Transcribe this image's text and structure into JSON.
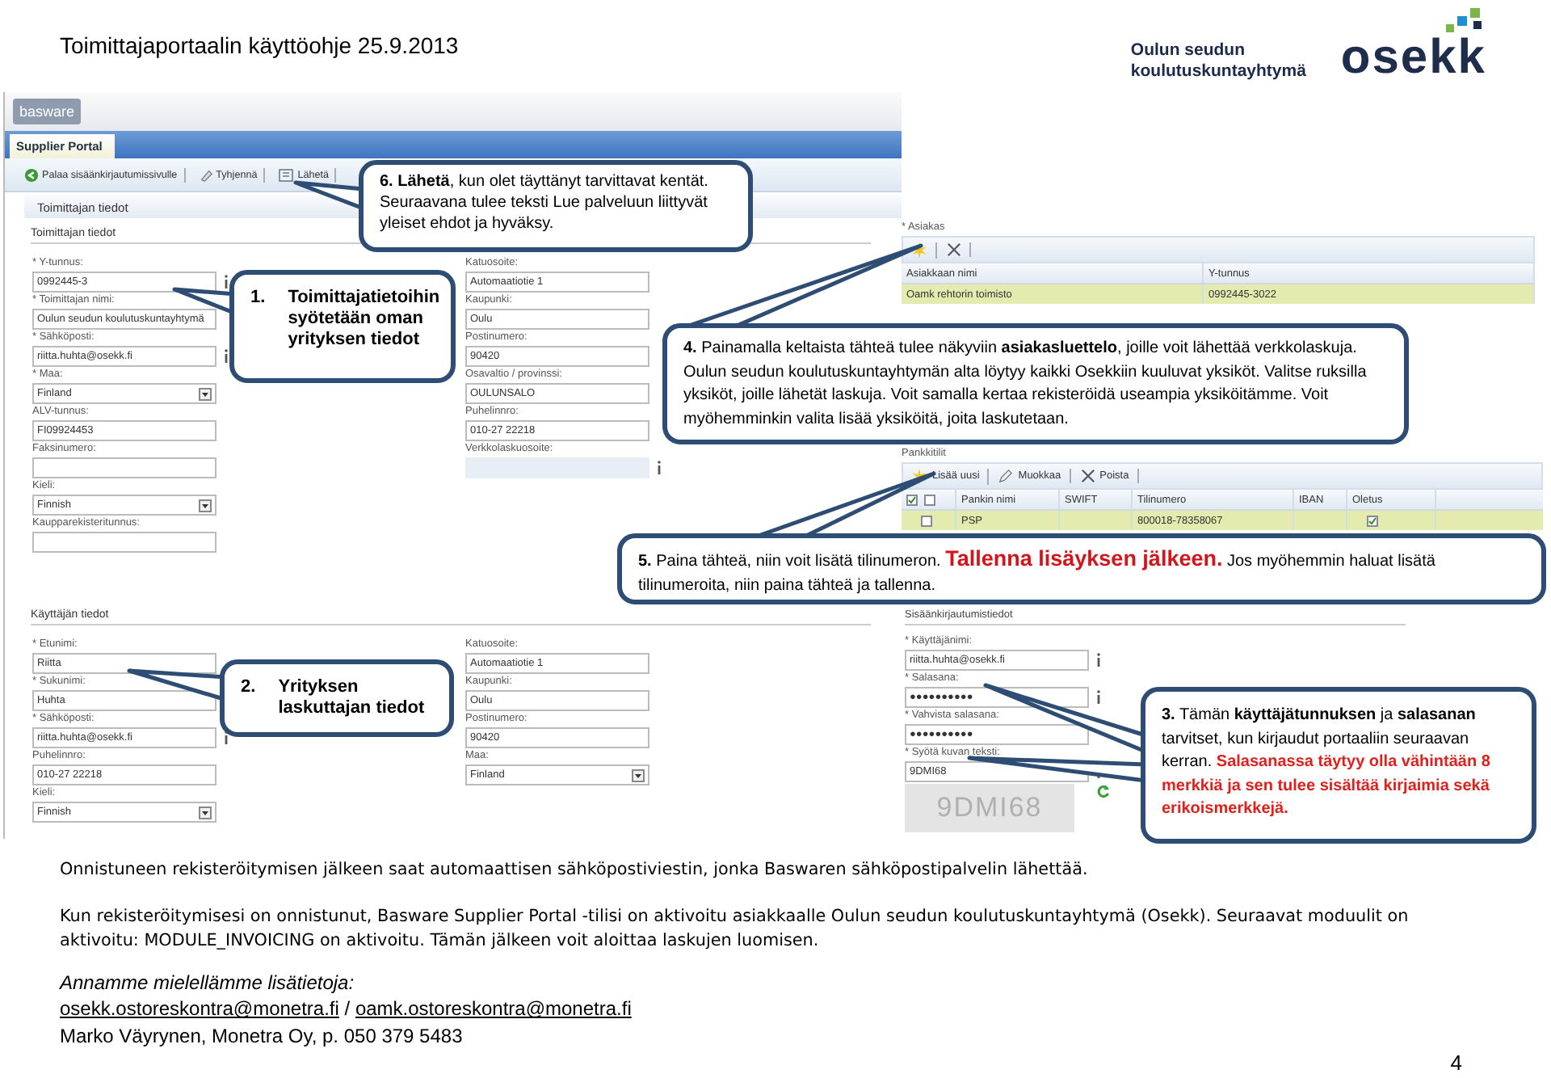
{
  "header": {
    "title": "Toimittajaportaalin käyttöohje 25.9.2013",
    "org_name": "Oulun seudun koulutuskuntayhtymä",
    "logo_text": "osekk"
  },
  "portal": {
    "logo_text": "basware",
    "tab": "Supplier Portal",
    "toolbar": [
      {
        "label": "Palaa sisäänkirjautumissivulle",
        "kind": "back"
      },
      {
        "label": "Tyhjennä",
        "kind": "eraser"
      },
      {
        "label": "Lähetä",
        "kind": "send"
      }
    ],
    "section_title": "Toimittajan tiedot",
    "supplier": {
      "heading": "Toimittajan tiedot",
      "left": [
        {
          "label": "* Y-tunnus:",
          "value": "0992445-3",
          "kind": "text",
          "info": true
        },
        {
          "label": "* Toimittajan nimi:",
          "value": "Oulun seudun koulutuskuntayhtymä",
          "kind": "text",
          "info": false
        },
        {
          "label": "* Sähköposti:",
          "value": "riitta.huhta@osekk.fi",
          "kind": "text",
          "info": true
        },
        {
          "label": "* Maa:",
          "value": "Finland",
          "kind": "select",
          "info": false
        },
        {
          "label": "ALV-tunnus:",
          "value": "FI09924453",
          "kind": "text",
          "info": false
        },
        {
          "label": "Faksinumero:",
          "kind": "text",
          "info": false
        },
        {
          "label": "Kieli:",
          "value": "Finnish",
          "kind": "select",
          "info": false
        },
        {
          "label": "Kaupparekisteritunnus:",
          "kind": "text",
          "info": false
        }
      ],
      "middle": [
        {
          "label": "Katuosoite:",
          "value": "Automaatiotie 1",
          "kind": "text",
          "info": false
        },
        {
          "label": "Kaupunki:",
          "value": "Oulu",
          "kind": "text",
          "info": false
        },
        {
          "label": "Postinumero:",
          "value": "90420",
          "kind": "text",
          "info": false
        },
        {
          "label": "Osavaltio / provinssi:",
          "value": "OULUNSALO",
          "kind": "text",
          "info": false
        },
        {
          "label": "Puhelinnro:",
          "value": "010-27 22218",
          "kind": "text",
          "info": false
        },
        {
          "label": "Verkkolaskuosoite:",
          "kind": "readonly",
          "info": true
        }
      ]
    },
    "user": {
      "heading": "Käyttäjän tiedot",
      "left": [
        {
          "label": "* Etunimi:",
          "value": "Riitta",
          "kind": "text",
          "info": false
        },
        {
          "label": "* Sukunimi:",
          "value": "Huhta",
          "kind": "text",
          "info": false
        },
        {
          "label": "* Sähköposti:",
          "value": "riitta.huhta@osekk.fi",
          "kind": "text",
          "info": true
        },
        {
          "label": "Puhelinnro:",
          "value": "010-27 22218",
          "kind": "text",
          "info": false
        },
        {
          "label": "Kieli:",
          "value": "Finnish",
          "kind": "select",
          "info": false
        }
      ],
      "middle": [
        {
          "label": "Katuosoite:",
          "value": "Automaatiotie 1",
          "kind": "text",
          "info": false
        },
        {
          "label": "Kaupunki:",
          "value": "Oulu",
          "kind": "text",
          "info": false
        },
        {
          "label": "Postinumero:",
          "value": "90420",
          "kind": "text",
          "info": false
        },
        {
          "label": "Maa:",
          "value": "Finland",
          "kind": "select",
          "info": false
        }
      ]
    }
  },
  "customers": {
    "label": "* Asiakas",
    "toolbar": [
      {
        "kind": "star"
      },
      {
        "kind": "x"
      }
    ],
    "columns": [
      "Asiakkaan nimi",
      "Y-tunnus"
    ],
    "rows": [
      {
        "name": "Oamk rehtorin toimisto",
        "business_id": "0992445-3022",
        "selected": true
      }
    ]
  },
  "bank_accounts": {
    "label": "Pankkitilit",
    "toolbar": [
      {
        "label": "Lisää uusi",
        "kind": "star"
      },
      {
        "label": "Muokkaa",
        "kind": "pencil"
      },
      {
        "label": "Poista",
        "kind": "x"
      }
    ],
    "header_checkboxes": [
      {
        "checked": true
      },
      {
        "checked": false
      }
    ],
    "columns": [
      "Pankin nimi",
      "SWIFT",
      "Tilinumero",
      "IBAN",
      "Oletus"
    ],
    "rows": [
      {
        "checked": false,
        "bank_name": "PSP",
        "account_number": "800018-78358067",
        "default": true,
        "selected": true
      }
    ]
  },
  "login": {
    "heading": "Sisäänkirjautumistiedot",
    "fields": [
      {
        "label": "* Käyttäjänimi:",
        "value": "riitta.huhta@osekk.fi",
        "info": true
      },
      {
        "label": "* Salasana:",
        "value": "●●●●●●●●●●",
        "info": true
      },
      {
        "label": "* Vahvista salasana:",
        "value": "●●●●●●●●●●",
        "info": false
      },
      {
        "label": "* Syötä kuvan teksti:",
        "value": "9DMI68",
        "info": true
      }
    ],
    "captcha": "9DMI68"
  },
  "callouts": [
    {
      "segments": [
        {
          "kind": "plain",
          "text": "**6. Lähetä**, kun olet täyttänyt tarvittavat kentät. Seuraavana tulee teksti Lue palveluun liittyvät yleiset ehdot ja hyväksy."
        }
      ]
    },
    {
      "number": "1.",
      "segments": [
        {
          "kind": "bold",
          "text": "Toimittajatietoihin syötetään oman yrityksen tiedot"
        }
      ]
    },
    {
      "segments": [
        {
          "kind": "plain",
          "text": "**4.** Painamalla keltaista tähteä tulee näkyviin **asiakasluettelo**, joille voit lähettää verkkolaskuja. Oulun seudun koulutuskuntayhtymän alta löytyy kaikki Osekkiin kuuluvat yksiköt. Valitse ruksilla yksiköt, joille lähetät laskuja. Voit samalla kertaa rekisteröidä useampia yksiköitämme. Voit  myöhemminkin valita lisää yksiköitä, joita laskutetaan."
        }
      ]
    },
    {
      "segments": [
        {
          "kind": "plain",
          "text": "**5.** Paina tähteä, niin voit lisätä tilinumeron. "
        },
        {
          "kind": "alert_large",
          "text": "Tallenna lisäyksen jälkeen."
        },
        {
          "kind": "plain",
          "text": " Jos myöhemmin haluat  lisätä tilinumeroita, niin paina tähteä ja tallenna."
        }
      ]
    },
    {
      "number": "2.",
      "segments": [
        {
          "kind": "bold",
          "text": "Yrityksen laskuttajan tiedot"
        }
      ]
    },
    {
      "segments": [
        {
          "kind": "plain",
          "text": "**3.** Tämän **käyttäjätunnuksen** ja **salasanan** tarvitset, kun kirjaudut portaaliin seuraavan kerran. "
        },
        {
          "kind": "alert",
          "text": "Salasanassa täytyy olla vähintään 8 merkkiä ja sen tulee sisältää kirjaimia sekä erikoismerkkejä."
        }
      ]
    }
  ],
  "paragraphs": [
    "Onnistuneen rekisteröitymisen jälkeen saat automaattisen sähköpostiviestin, jonka Baswaren sähköpostipalvelin lähettää.",
    "Kun rekisteröitymisesi on onnistunut, Basware Supplier Portal -tilisi on aktivoitu asiakkaalle Oulun seudun koulutuskuntayhtymä (Osekk). Seuraavat moduulit on aktivoitu: MODULE_INVOICING on aktivoitu.  Tämän jälkeen voit aloittaa laskujen luomisen."
  ],
  "contact": {
    "heading": "Annamme mielellämme lisätietoja:",
    "links": [
      "osekk.ostoreskontra@monetra.fi",
      "oamk.ostoreskontra@monetra.fi"
    ],
    "separator": "/",
    "person": "Marko Väyrynen, Monetra Oy, p. 050 379 5483"
  },
  "page_number": "4"
}
